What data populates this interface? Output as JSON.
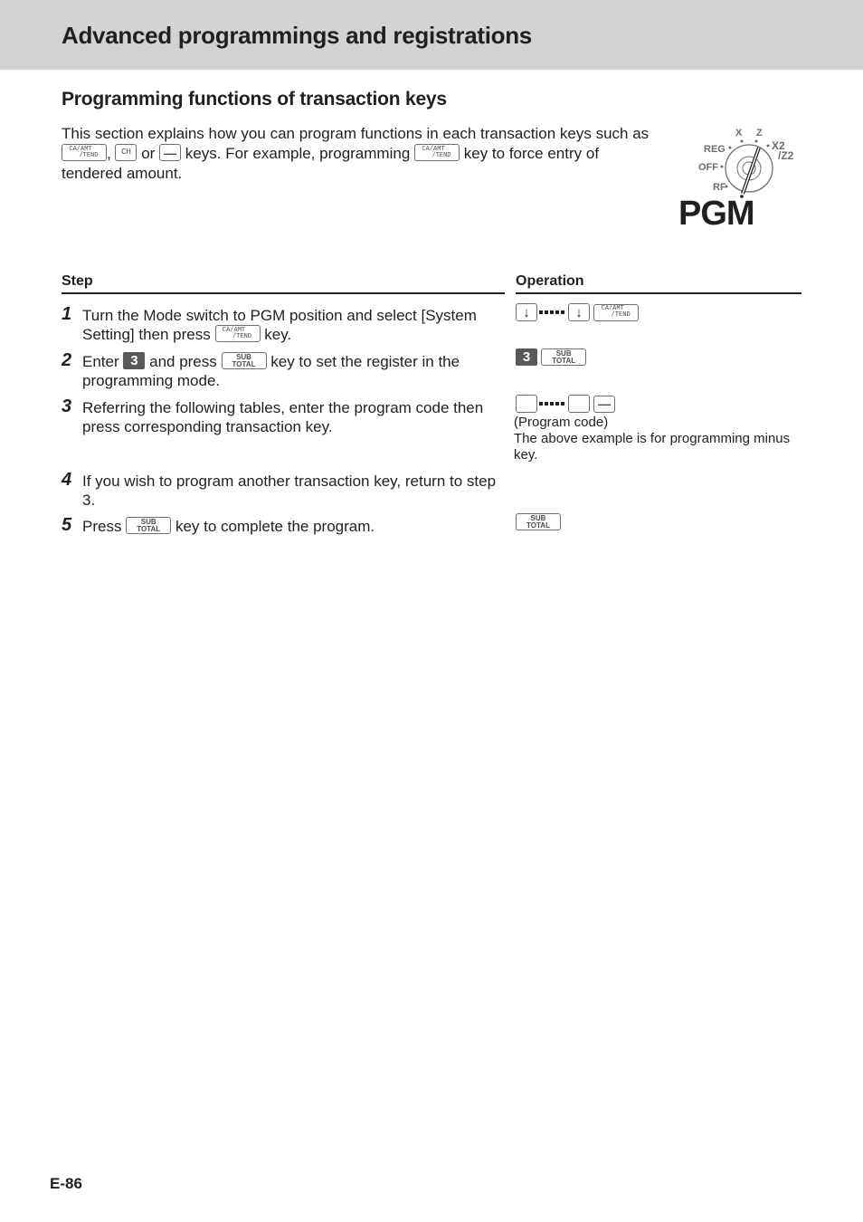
{
  "header": {
    "title": "Advanced programmings and registrations"
  },
  "section": {
    "title": "Programming functions of transaction keys",
    "intro": {
      "part1": "This section explains how you can program functions in each transaction keys such as",
      "comma": ",",
      "or": "or",
      "part2": "keys. For example, programming",
      "part3": "key to force entry of tendered amount."
    }
  },
  "keys": {
    "ca_amt_tend": {
      "line1": "CA/AMT",
      "line2": "/TEND"
    },
    "ch": "CH",
    "minus": "—",
    "sub_total": {
      "line1": "SUB",
      "line2": "TOTAL"
    },
    "arrow_down": "↓",
    "num3": "3"
  },
  "mode_switch": {
    "positions": [
      "REG",
      "OFF",
      "RF",
      "X",
      "Z",
      "X2",
      "/Z2"
    ],
    "selected": "PGM"
  },
  "table": {
    "step_header": "Step",
    "operation_header": "Operation",
    "steps": [
      {
        "num": "1",
        "text_a": "Turn the Mode switch to PGM position and select [System Setting] then press",
        "text_b": "key."
      },
      {
        "num": "2",
        "text_a": "Enter",
        "text_b": "and press",
        "text_c": "key to set the register in the programming mode."
      },
      {
        "num": "3",
        "text_a": "Referring the following tables, enter the program code then press corresponding transaction key."
      },
      {
        "num": "4",
        "text_a": "If you wish to program another transaction key, return to step 3."
      },
      {
        "num": "5",
        "text_a": "Press",
        "text_b": "key to complete the program."
      }
    ],
    "operations": {
      "step3_label": "(Program code)",
      "step3_note": "The above example is for programming minus key."
    }
  },
  "footer": {
    "page_number": "E-86"
  }
}
